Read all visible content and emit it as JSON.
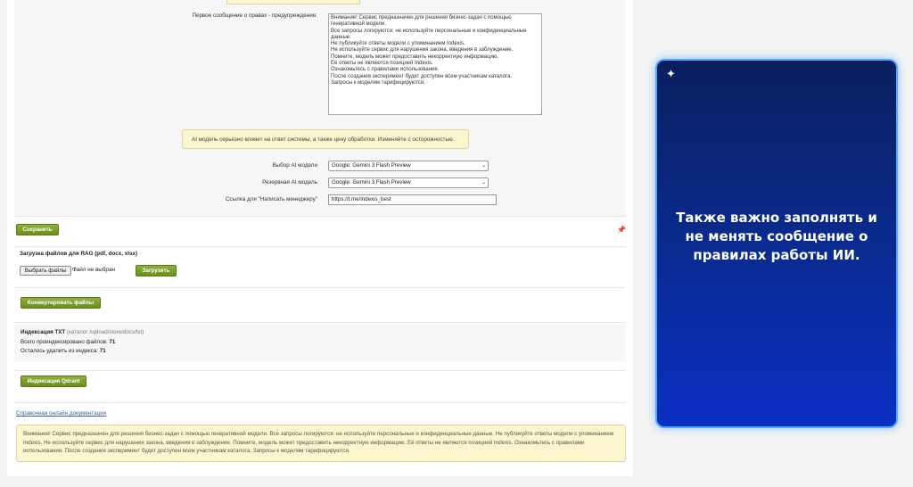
{
  "settings": {
    "first_message_label": "Первое сообщение о правах - предупреждение:",
    "first_message_value": "Внимание! Сервис предназначен для решения бизнес-задач с помощью генеративной модели.\nВсе запросы логируются: не используйте персональные и конфиденциальные данные.\nНе публикуйте ответы модели с упоминанием Indexis.\nНе используйте сервис для нарушения закона, введения в заблуждение.\nПомните, модель может предоставить некорректную информацию.\nЕё ответы не являются позицией Indexis.\nОзнакомьтесь с правилами использования.\nПосле создания эксперимент будет доступен всем участникам каталога.\nЗапросы к моделям тарифицируются.",
    "ai_warning": "AI модель серьезно влияет на ответ системы, а также цену обработки. Изменяйте с осторожностью.",
    "ai_model_label": "Выбор AI модели",
    "ai_model_value": "Google: Gemini 3 Flash Preview",
    "backup_model_label": "Резервная AI модель",
    "backup_model_value": "Google: Gemini 3 Flash Preview",
    "manager_link_label": "Ссылка для \"Написать менеджеру\"",
    "manager_link_value": "https://t.me/indexis_best",
    "save_label": "Сохранить"
  },
  "rag_upload": {
    "title": "Загрузка файлов для RAG (pdf, docx, xlsx)",
    "choose_files_label": "Выбрать файлы",
    "no_file_text": "Файл не выбран",
    "upload_label": "Загрузить",
    "convert_label": "Конвертировать файлы"
  },
  "indexing": {
    "title": "Индексация TXT",
    "catalog_note": "(каталог /upload/store/docs/txt)",
    "indexed_label": "Всего проиндексировано файлов:",
    "indexed_count": "71",
    "remaining_label": "Осталось удалить из индекса:",
    "remaining_count": "71",
    "qdrant_label": "Индексация Qdrant"
  },
  "footer": {
    "doc_link": "Справочная онлайн документация",
    "disclaimer": "Внимание! Сервис предназначен для решения бизнес-задач с помощью генеративной модели. Все запросы логируются: не используйте персональные и конфиденциальные данные. Не публикуйте ответы модели с упоминанием Indexis. Не используйте сервис для нарушения закона, введения в заблуждение. Помните, модель может предоставить некорректную информацию. Её ответы не являются позицией Indexis. Ознакомьтесь с правилами использования. После создания эксперимент будет доступен всем участникам каталога. Запросы к моделям тарифицируются."
  },
  "promo": {
    "text": "Также важно заполнять и не менять сообщение о правилах работы ИИ.",
    "icon": "sparkle-icon"
  },
  "colors": {
    "button_green": "#7a9e2a",
    "note_yellow": "#fbf6cd",
    "promo_blue": "#0a2fc2",
    "promo_border": "#4ea8ff"
  }
}
